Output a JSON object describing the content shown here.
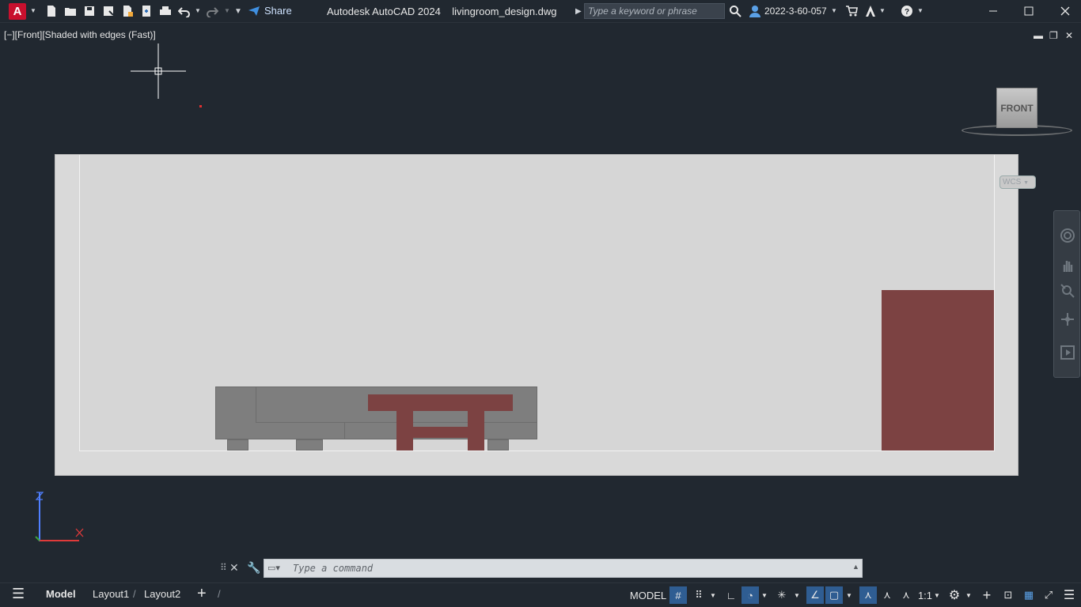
{
  "app": {
    "logo_letter": "A",
    "title": "Autodesk AutoCAD 2024    livingroom_design.dwg"
  },
  "toolbar": {
    "share_label": "Share"
  },
  "search": {
    "placeholder": "Type a keyword or phrase"
  },
  "user": {
    "name": "2022-3-60-057"
  },
  "viewport": {
    "label": "[−][Front][Shaded with edges (Fast)]"
  },
  "viewcube": {
    "face": "FRONT",
    "wcs_label": "WCS"
  },
  "ucs": {
    "y_axis": "Z",
    "x_axis": "X"
  },
  "command": {
    "placeholder": "Type  a  command"
  },
  "tabs": [
    {
      "label": "Model",
      "active": true
    },
    {
      "label": "Layout1"
    },
    {
      "label": "Layout2"
    }
  ],
  "status": {
    "model_label": "MODEL",
    "scale_label": "1:1"
  },
  "colors": {
    "accent": "#2f5d92",
    "furniture_red": "#7c4242",
    "sofa_grey": "#7e7e7e",
    "brand": "#c8102e"
  }
}
